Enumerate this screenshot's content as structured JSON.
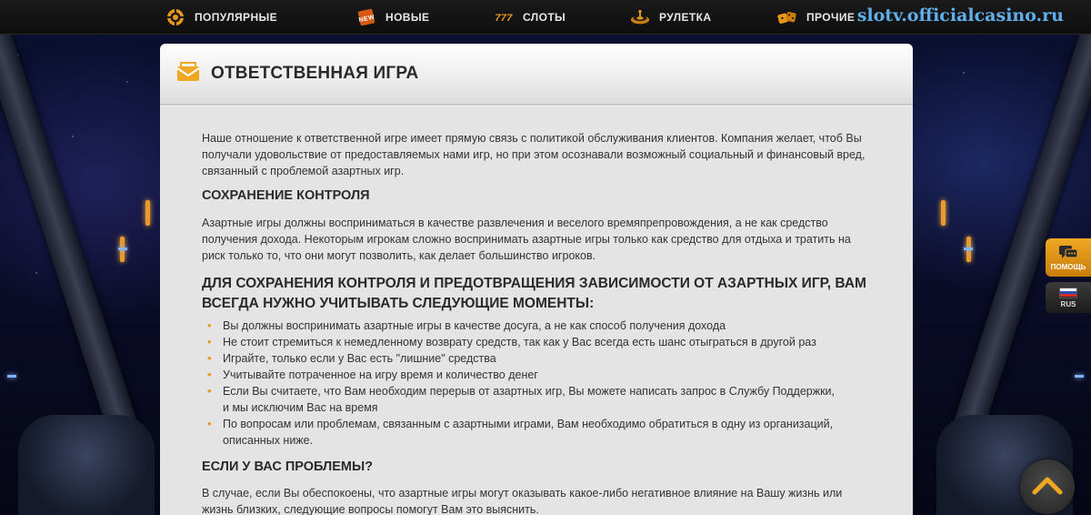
{
  "nav": {
    "items": [
      {
        "label": "ПОПУЛЯРНЫЕ",
        "icon": "chip-icon"
      },
      {
        "label": "НОВЫЕ",
        "icon": "new-badge-icon"
      },
      {
        "label": "СЛОТЫ",
        "icon": "slots-777-icon"
      },
      {
        "label": "РУЛЕТКА",
        "icon": "roulette-icon"
      },
      {
        "label": "ПРОЧИЕ",
        "icon": "dice-icon"
      }
    ],
    "watermark": "slotv.officialcasino.ru"
  },
  "page": {
    "title": "ОТВЕТСТВЕННАЯ ИГРА",
    "intro": "Наше отношение к ответственной игре имеет прямую связь с политикой обслуживания клиентов. Компания желает, чтоб Вы получали удовольствие от предоставляемых нами игр, но при этом осознавали возможный социальный и финансовый вред, связанный с проблемой азартных игр.",
    "section1_title": "СОХРАНЕНИЕ КОНТРОЛЯ",
    "section1_text": "Азартные игры должны восприниматься в качестве развлечения и веселого времяпрепровождения, а не как средство получения дохода. Некоторым игрокам сложно воспринимать азартные игры только как средство для отдыха и тратить на риск только то, что они могут позволить, как делает большинство игроков.",
    "section2_title": "ДЛЯ СОХРАНЕНИЯ КОНТРОЛЯ И ПРЕДОТВРАЩЕНИЯ ЗАВИСИМОСТИ ОТ АЗАРТНЫХ ИГР, ВАМ ВСЕГДА НУЖНО УЧИТЫВАТЬ СЛЕДУЮЩИЕ МОМЕНТЫ:",
    "bullets": [
      "Вы должны воспринимать азартные игры в качестве досуга, а не как способ получения дохода",
      "Не стоит стремиться к немедленному возврату средств, так как у Вас всегда есть шанс отыграться в другой раз",
      "Играйте, только если у Вас есть \"лишние\" средства",
      "Учитывайте потраченное на игру время и количество денег",
      "Если Вы считаете, что Вам необходим перерыв от азартных игр, Вы можете написать запрос в Службу Поддержки, и мы исключим Вас на время",
      "По вопросам или проблемам, связанным с азартными играми, Вам необходимо обратиться в одну из организаций, описанных ниже."
    ],
    "section3_title": "ЕСЛИ У ВАС ПРОБЛЕМЫ?",
    "section3_text": "В случае, если Вы обеспокоены, что азартные игры могут оказывать какое-либо негативное влияние на Вашу жизнь или жизнь близких, следующие вопросы помогут Вам это выяснить."
  },
  "widgets": {
    "help_label": "ПОМОЩЬ",
    "lang_label": "RUS"
  },
  "colors": {
    "accent": "#e8961c",
    "watermark": "#5fb0ea"
  }
}
